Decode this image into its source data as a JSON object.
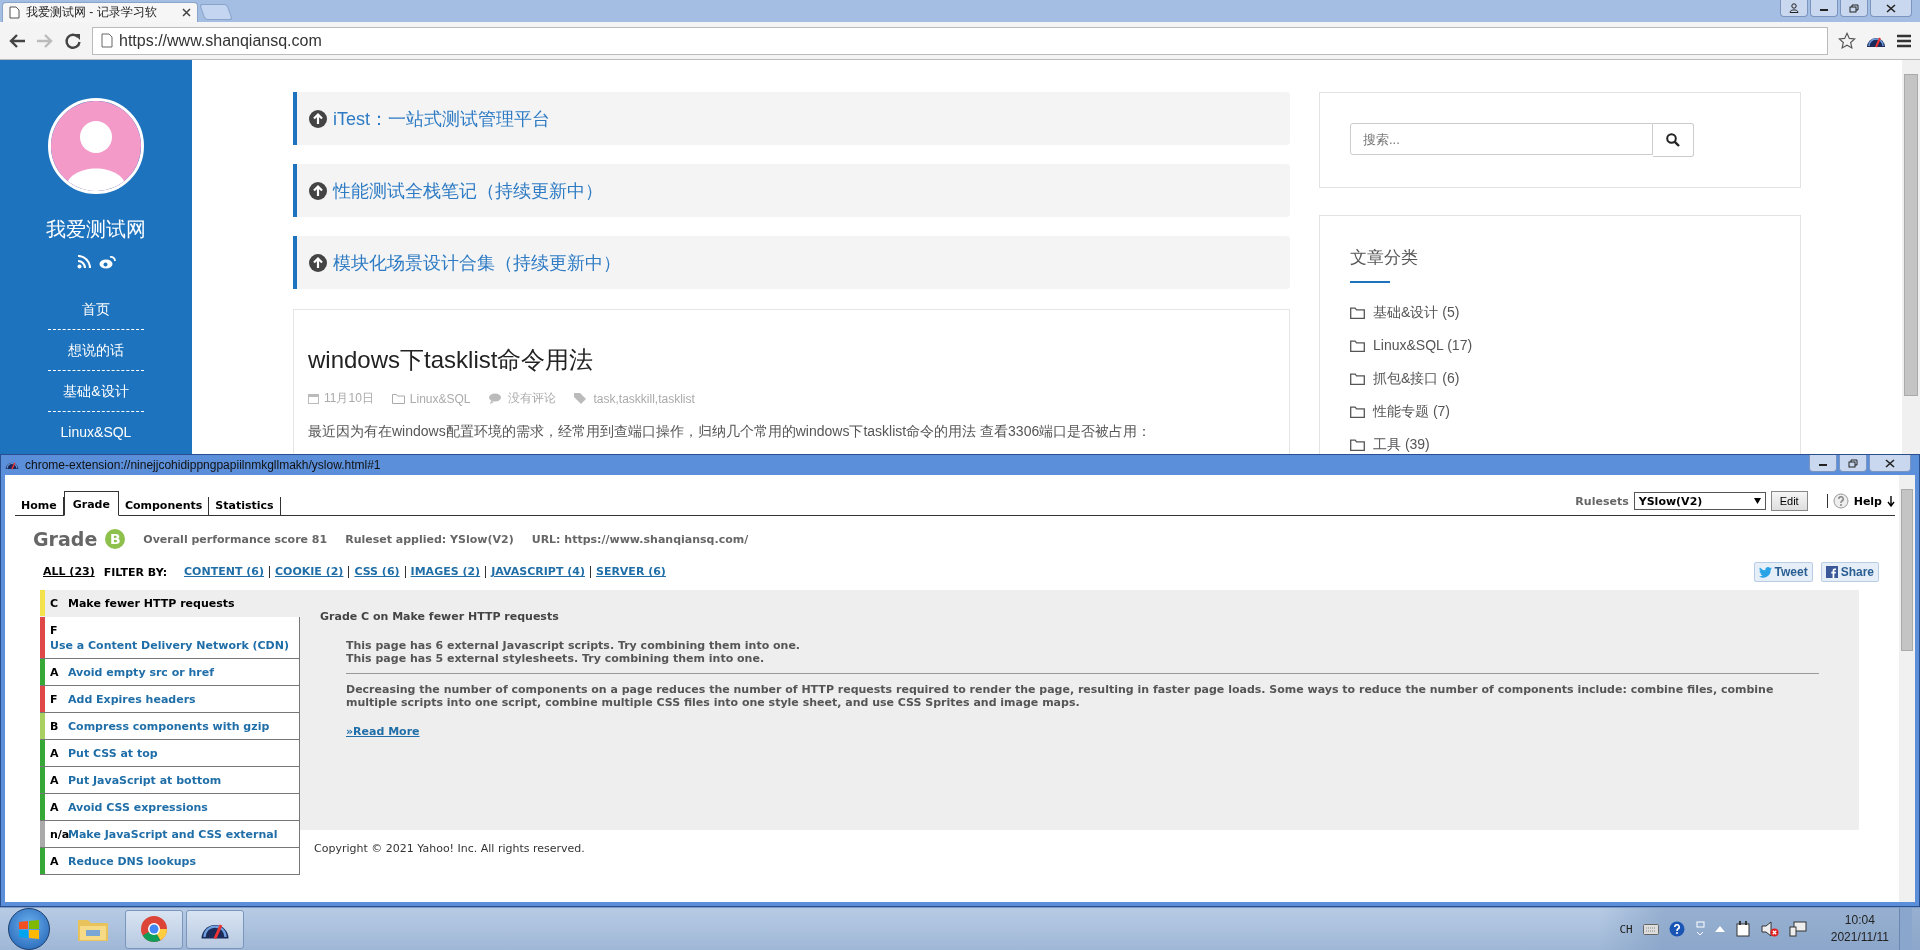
{
  "browser": {
    "tab": {
      "title": "我爱测试网 - 记录学习软"
    },
    "address": "https://www.shanqiansq.com",
    "forward_disabled": true
  },
  "site": {
    "name": "我爱测试网",
    "nav": [
      "首页",
      "想说的话",
      "基础&设计",
      "Linux&SQL"
    ]
  },
  "sticky_posts": [
    "iTest：一站式测试管理平台",
    "性能测试全栈笔记（持续更新中）",
    "模块化场景设计合集（持续更新中）"
  ],
  "article": {
    "title": "windows下tasklist命令用法",
    "date": "11月10日",
    "category": "Linux&SQL",
    "comments": "没有评论",
    "tags": "task,taskkill,tasklist",
    "excerpt": "最近因为有在windows配置环境的需求，经常用到查端口操作，归纳几个常用的windows下tasklist命令的用法 查看3306端口是否被占用："
  },
  "search": {
    "placeholder": "搜索..."
  },
  "categories": {
    "title": "文章分类",
    "items": [
      "基础&设计 (5)",
      "Linux&SQL (17)",
      "抓包&接口 (6)",
      "性能专题 (7)",
      "工具 (39)"
    ]
  },
  "yslow": {
    "window_title": "chrome-extension://ninejjcohidippngpapiilnmkgllmakh/yslow.html#1",
    "tabs": [
      {
        "label": "Home",
        "selected": false
      },
      {
        "label": "Grade",
        "selected": true
      },
      {
        "label": "Components",
        "selected": false
      },
      {
        "label": "Statistics",
        "selected": false
      }
    ],
    "rulesets_label": "Rulesets",
    "ruleset": "YSlow(V2)",
    "edit": "Edit",
    "help": "Help",
    "grade_label": "Grade",
    "grade": "B",
    "score": "Overall performance score 81",
    "ruleset_applied": "Ruleset applied: YSlow(V2)",
    "url": "URL: https://www.shanqiansq.com/",
    "filter_by": "FILTER BY:",
    "filters": [
      {
        "label": "ALL (23)",
        "selected": true
      },
      {
        "label": "CONTENT (6)",
        "selected": false
      },
      {
        "label": "COOKIE (2)",
        "selected": false
      },
      {
        "label": "CSS (6)",
        "selected": false
      },
      {
        "label": "IMAGES (2)",
        "selected": false
      },
      {
        "label": "JAVASCRIPT (4)",
        "selected": false
      },
      {
        "label": "SERVER (6)",
        "selected": false
      }
    ],
    "tweet": "Tweet",
    "share": "Share",
    "rules": [
      {
        "grade": "C",
        "name": "Make fewer HTTP requests",
        "color": "#f3e24b",
        "selected": true
      },
      {
        "grade": "F",
        "name": "Use a Content Delivery Network (CDN)",
        "color": "#e04848",
        "selected": false
      },
      {
        "grade": "A",
        "name": "Avoid empty src or href",
        "color": "#36a836",
        "selected": false
      },
      {
        "grade": "F",
        "name": "Add Expires headers",
        "color": "#e04848",
        "selected": false
      },
      {
        "grade": "B",
        "name": "Compress components with gzip",
        "color": "#a8d060",
        "selected": false
      },
      {
        "grade": "A",
        "name": "Put CSS at top",
        "color": "#36a836",
        "selected": false
      },
      {
        "grade": "A",
        "name": "Put JavaScript at bottom",
        "color": "#36a836",
        "selected": false
      },
      {
        "grade": "A",
        "name": "Avoid CSS expressions",
        "color": "#36a836",
        "selected": false
      },
      {
        "grade": "n/a",
        "name": "Make JavaScript and CSS external",
        "color": "#aaaaaa",
        "selected": false
      },
      {
        "grade": "A",
        "name": "Reduce DNS lookups",
        "color": "#36a836",
        "selected": false
      }
    ],
    "detail": {
      "heading": "Grade C on Make fewer HTTP requests",
      "messages": [
        "This page has 6 external Javascript scripts. Try combining them into one.",
        "This page has 5 external stylesheets. Try combining them into one."
      ],
      "description": "Decreasing the number of components on a page reduces the number of HTTP requests required to render the page, resulting in faster page loads. Some ways to reduce the number of components include: combine files, combine multiple scripts into one script, combine multiple CSS files into one style sheet, and use CSS Sprites and image maps.",
      "read_more": "»Read More"
    },
    "copyright": "Copyright © 2021 Yahoo! Inc. All rights reserved."
  },
  "taskbar": {
    "ime": "CH",
    "time": "10:04",
    "date": "2021/11/11"
  }
}
